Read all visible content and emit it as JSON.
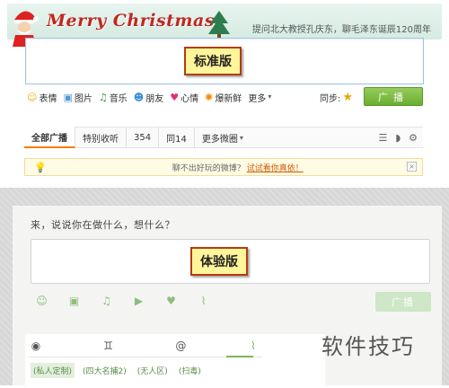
{
  "standard": {
    "banner": {
      "title": "Merry Christmas",
      "hot_topic": "提问北大教授孔庆东，聊毛泽东诞辰120周年"
    },
    "version_tag": "标准版",
    "toolbar": [
      {
        "icon": "smile-icon",
        "label": "表情"
      },
      {
        "icon": "image-icon",
        "label": "图片"
      },
      {
        "icon": "music-icon",
        "label": "音乐"
      },
      {
        "icon": "friends-icon",
        "label": "朋友"
      },
      {
        "icon": "heart-icon",
        "label": "心情"
      },
      {
        "icon": "news-icon",
        "label": "爆新鲜"
      },
      {
        "icon": "chevron-down-icon",
        "label": "更多"
      }
    ],
    "sync_label": "同步:",
    "post_button": "广播",
    "tabs": [
      {
        "label": "全部广播",
        "active": true
      },
      {
        "label": "特别收听",
        "active": false
      },
      {
        "label": "354",
        "active": false
      },
      {
        "label": "同14",
        "active": false
      },
      {
        "label": "更多微圈",
        "active": false
      }
    ],
    "notice": {
      "text": "聊不出好玩的微博？",
      "link": "试试看你真依！"
    }
  },
  "experience": {
    "prompt": "来，说说你在做什么，想什么？",
    "version_tag": "体验版",
    "toolbar_icons": [
      "smile-icon",
      "image-icon",
      "music-icon",
      "video-icon",
      "heart-icon",
      "rss-icon"
    ],
    "post_button": "广播",
    "nav_icons": [
      "chat-icon",
      "friends-icon",
      "at-icon",
      "rss-icon"
    ],
    "chips": [
      {
        "label": "(私人定制)",
        "active": true
      },
      {
        "label": "(四大名捕2)",
        "active": false
      },
      {
        "label": "(无人区)",
        "active": false
      },
      {
        "label": "(扫毒)",
        "active": false
      }
    ]
  },
  "watermark": "软件技巧",
  "colors": {
    "accent_green": "#6aae2e",
    "banner_red": "#c0271f",
    "tag_border": "#b43c10"
  }
}
